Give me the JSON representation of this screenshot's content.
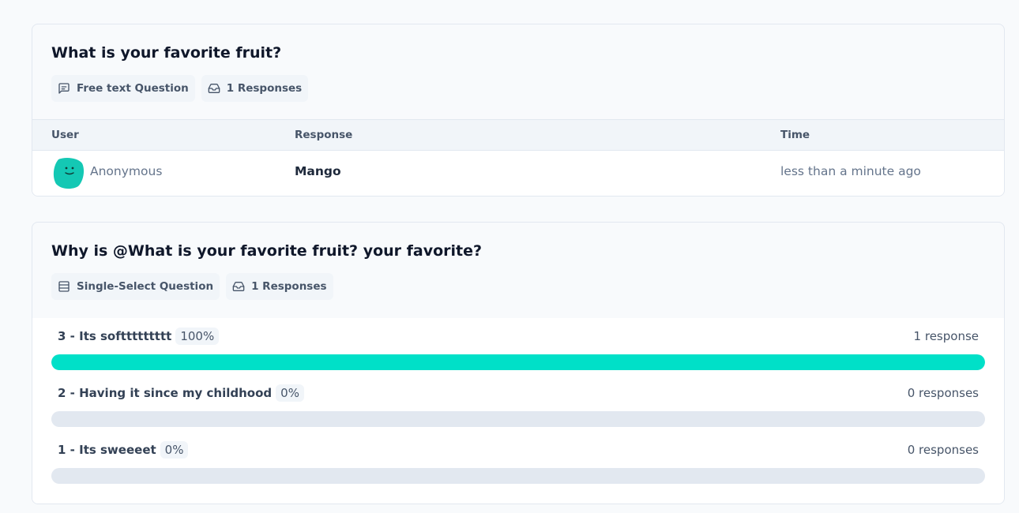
{
  "questions": [
    {
      "title": "What is your favorite fruit?",
      "type_label": "Free text Question",
      "type_icon": "message-square-icon",
      "responses_label": "1 Responses",
      "responses_icon": "inbox-icon",
      "table": {
        "headers": [
          "User",
          "Response",
          "Time"
        ],
        "rows": [
          {
            "user": "Anonymous",
            "response": "Mango",
            "time": "less than a minute ago"
          }
        ]
      }
    },
    {
      "title": "Why is @What is your favorite fruit? your favorite?",
      "type_label": "Single-Select Question",
      "type_icon": "list-icon",
      "responses_label": "1 Responses",
      "responses_icon": "inbox-icon",
      "choices": [
        {
          "label": "3 - Its softtttttttt",
          "percent_label": "100%",
          "count_label": "1 response",
          "fraction": 1.0
        },
        {
          "label": "2 - Having it since my childhood",
          "percent_label": "0%",
          "count_label": "0 responses",
          "fraction": 0.0
        },
        {
          "label": "1 - Its sweeeet",
          "percent_label": "0%",
          "count_label": "0 responses",
          "fraction": 0.0
        }
      ]
    }
  ],
  "colors": {
    "accent": "#00e0c8",
    "avatar": "#14c8b4",
    "bar_track": "#e2e8f0"
  }
}
